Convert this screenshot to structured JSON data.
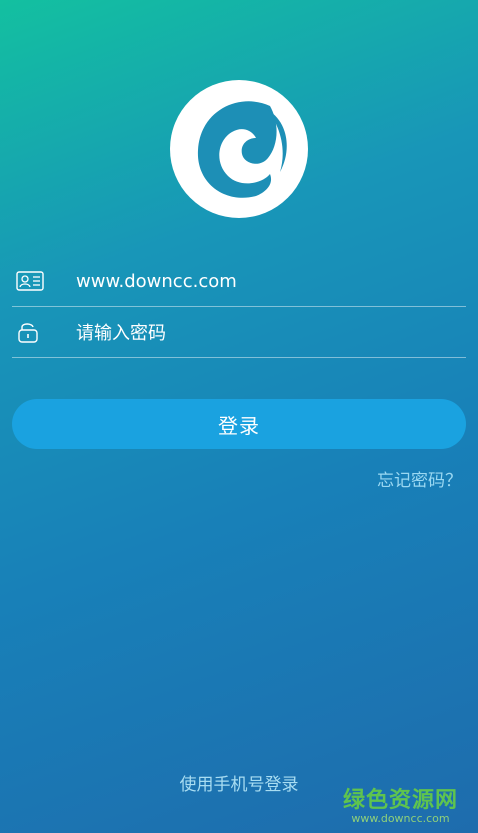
{
  "logo": {
    "icon": "app-logo-icon"
  },
  "account": {
    "icon": "id-card-icon",
    "value": "www.downcc.com"
  },
  "password": {
    "icon": "lock-icon",
    "placeholder": "请输入密码"
  },
  "login_button": {
    "label": "登录",
    "color": "#1aa2e0"
  },
  "forgot_password": "忘记密码？",
  "phone_login": "使用手机号登录",
  "watermark": {
    "main": "绿色资源网",
    "sub": "www.downcc.com",
    "color": "#5fc44e"
  }
}
